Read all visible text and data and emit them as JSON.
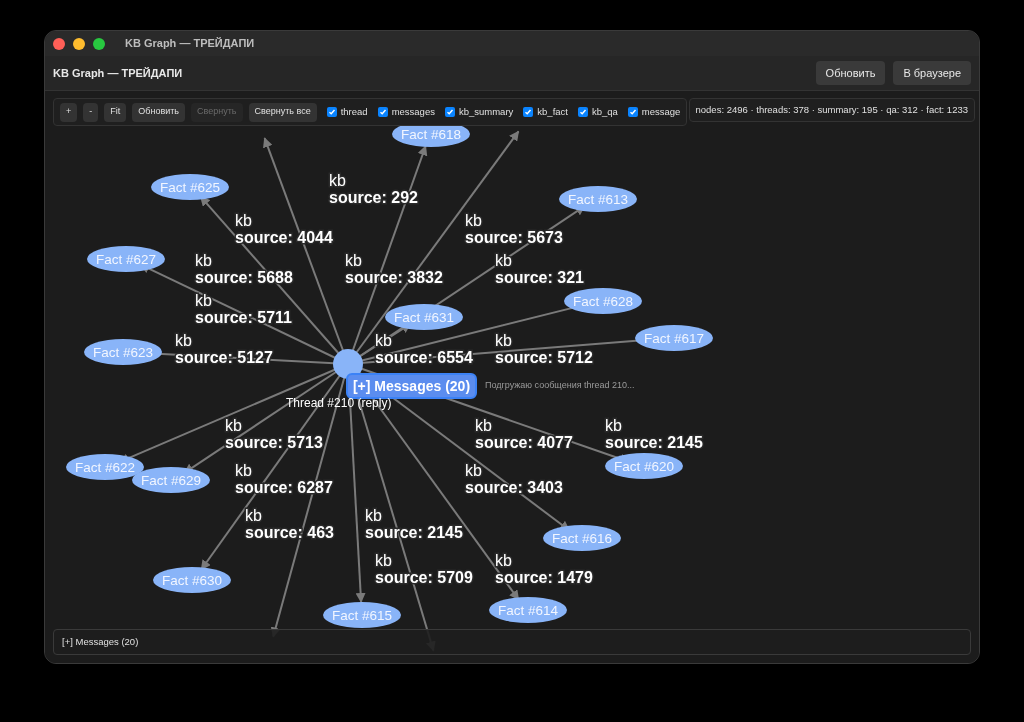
{
  "window": {
    "title": "KB Graph — ТРЕЙДАПИ"
  },
  "header": {
    "title": "KB Graph — ТРЕЙДАПИ",
    "buttons": [
      "Обновить",
      "В браузере"
    ]
  },
  "toolbar": {
    "buttons": [
      {
        "label": "+",
        "disabled": false
      },
      {
        "label": "-",
        "disabled": false
      },
      {
        "label": "Fit",
        "disabled": false
      },
      {
        "label": "Обновить",
        "disabled": false
      },
      {
        "label": "Свернуть",
        "disabled": true
      },
      {
        "label": "Свернуть все",
        "disabled": false
      }
    ],
    "filters": [
      {
        "label": "thread",
        "checked": true
      },
      {
        "label": "messages",
        "checked": true
      },
      {
        "label": "kb_summary",
        "checked": true
      },
      {
        "label": "kb_fact",
        "checked": true
      },
      {
        "label": "kb_qa",
        "checked": true
      },
      {
        "label": "message",
        "checked": true
      }
    ]
  },
  "stats": "nodes: 2496 · threads: 378 · summary: 195 · qa: 312 · fact: 1233",
  "graph": {
    "thread_label": "Thread #210 (reply)",
    "messages_node": "[+] Messages (20)",
    "loading": "Подгружаю сообщения thread 210...",
    "nodes": [
      {
        "label": "Fact #618"
      },
      {
        "label": "Fact #625"
      },
      {
        "label": "Fact #613"
      },
      {
        "label": "Fact #627"
      },
      {
        "label": "Fact #628"
      },
      {
        "label": "Fact #631"
      },
      {
        "label": "Fact #617"
      },
      {
        "label": "Fact #623"
      },
      {
        "label": "Fact #620"
      },
      {
        "label": "Fact #622"
      },
      {
        "label": "Fact #629"
      },
      {
        "label": "Fact #616"
      },
      {
        "label": "Fact #630"
      },
      {
        "label": "Fact #614"
      },
      {
        "label": "Fact #615"
      }
    ],
    "edge_labels": [
      {
        "relation": "kb",
        "source": "source: 292"
      },
      {
        "relation": "kb",
        "source": "source: 4044"
      },
      {
        "relation": "kb",
        "source": "source: 5673"
      },
      {
        "relation": "kb",
        "source": "source: 5688"
      },
      {
        "relation": "kb",
        "source": "source: 3832"
      },
      {
        "relation": "kb",
        "source": "source: 321"
      },
      {
        "relation": "kb",
        "source": "source: 5711"
      },
      {
        "relation": "kb",
        "source": "source: 5127"
      },
      {
        "relation": "kb",
        "source": "source: 6554"
      },
      {
        "relation": "kb",
        "source": "source: 5712"
      },
      {
        "relation": "kb",
        "source": "source: 5713"
      },
      {
        "relation": "kb",
        "source": "source: 4077"
      },
      {
        "relation": "kb",
        "source": "source: 2145"
      },
      {
        "relation": "kb",
        "source": "source: 6287"
      },
      {
        "relation": "kb",
        "source": "source: 3403"
      },
      {
        "relation": "kb",
        "source": "source: 463"
      },
      {
        "relation": "kb",
        "source": "source: 2145"
      },
      {
        "relation": "kb",
        "source": "source: 5709"
      },
      {
        "relation": "kb",
        "source": "source: 1479"
      }
    ]
  },
  "bottom_panel": {
    "label": "[+] Messages (20)"
  }
}
